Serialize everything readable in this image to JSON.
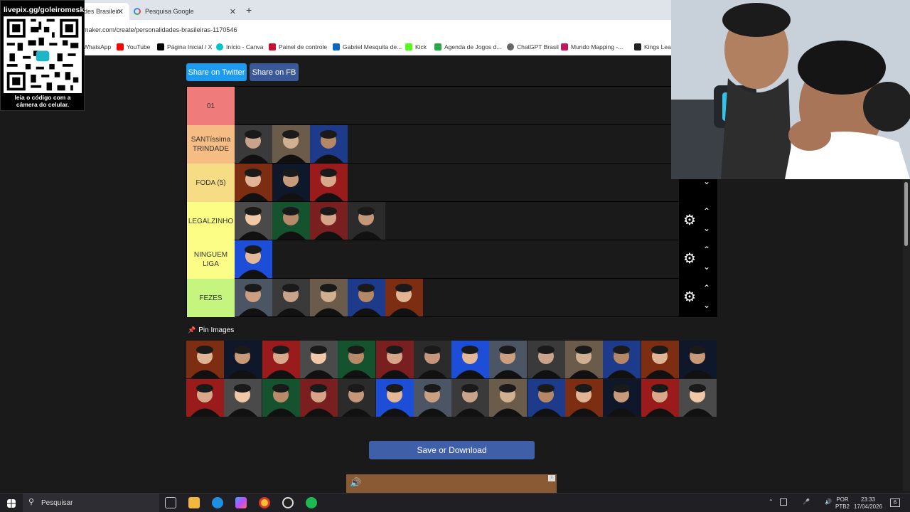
{
  "browser": {
    "tabs": [
      {
        "label": "des Brasileir",
        "active": true
      },
      {
        "label": "Pesquisa Google",
        "active": false
      }
    ],
    "close_glyph": "✕",
    "new_tab_glyph": "+",
    "url": "maker.com/create/personalidades-brasileiras-1170546",
    "bookmarks": [
      {
        "label": "WhatsApp",
        "color": "#25d366"
      },
      {
        "label": "YouTube",
        "color": "#ff0000"
      },
      {
        "label": "Página Inicial / X",
        "color": "#000000"
      },
      {
        "label": "Início - Canva",
        "color": "#00c4cc"
      },
      {
        "label": "Painel de controle",
        "color": "#c8102e"
      },
      {
        "label": "Gabriel Mesquita de...",
        "color": "#0a66c2"
      },
      {
        "label": "Kick",
        "color": "#53fc18"
      },
      {
        "label": "Agenda de Jogos d...",
        "color": "#2aa745"
      },
      {
        "label": "ChatGPT Brasil",
        "color": "#666666"
      },
      {
        "label": "Mundo Mapping -...",
        "color": "#c2185b"
      },
      {
        "label": "Kings Leag",
        "color": "#222222"
      }
    ]
  },
  "overlay": {
    "title": "livepix.gg/goleiromesk",
    "caption": "leia o código com a câmera do celular."
  },
  "share": {
    "twitter": "Share on Twitter",
    "fb": "Share on FB"
  },
  "tiers": [
    {
      "label": "01",
      "color": "#f07b7b",
      "count": 0
    },
    {
      "label": "SANTíssima TRINDADE",
      "color": "#f5bc83",
      "count": 3
    },
    {
      "label": "FODA (5)",
      "color": "#f6dc85",
      "count": 3
    },
    {
      "label": "LEGALZINHO",
      "color": "#fbfd84",
      "count": 4
    },
    {
      "label": "NINGUEM LIGA",
      "color": "#fcfd86",
      "count": 1
    },
    {
      "label": "FEZES",
      "color": "#c5f57f",
      "count": 5
    }
  ],
  "controls": {
    "gear": "⚙",
    "up": "⌃",
    "down": "⌄"
  },
  "pin_label": "Pin Images",
  "pool_count": 29,
  "save_label": "Save or Download",
  "taskbar": {
    "search_placeholder": "Pesquisar",
    "lang_top": "POR",
    "lang_bottom": "PTB2",
    "time": "23:33",
    "date": "17/04/2026",
    "notifications": "6"
  }
}
